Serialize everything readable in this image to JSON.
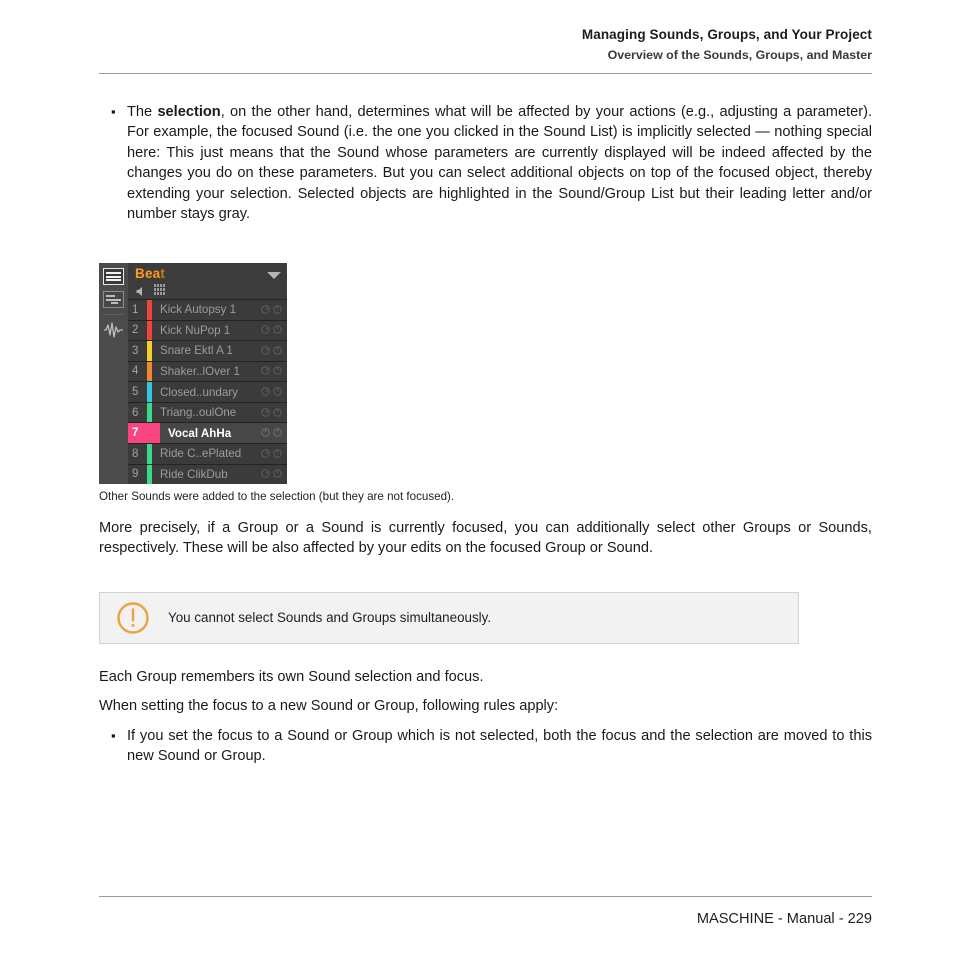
{
  "header": {
    "chapter": "Managing Sounds, Groups, and Your Project",
    "section": "Overview of the Sounds, Groups, and Master"
  },
  "content": {
    "bullet_1": {
      "marker": "▪",
      "text_before_bold": "The ",
      "bold": "selection",
      "text_after_bold": ", on the other hand, determines what will be affected by your actions (e.g., adjusting a parameter). For example, the focused Sound (i.e. the one you clicked in the Sound List) is implicitly selected — nothing special here: This just means that the Sound whose parameters are currently displayed will be indeed affected by the changes you do on these parameters. But you can select additional objects on top of the focused object, thereby extending your selection. Selected objects are highlighted in the Sound/Group List but their leading letter and/or number stays gray."
    },
    "caption": "Other Sounds were added to the selection (but they are not focused).",
    "para_1": "More precisely, if a Group or a Sound is currently focused, you can additionally select other Groups or Sounds, respectively. These will be also affected by your edits on the focused Group or Sound.",
    "note": {
      "icon": "exclamation-circle-icon",
      "text": "You cannot select Sounds and Groups simultaneously.",
      "accent_color": "#eba33f"
    },
    "para_2": "Each Group remembers its own Sound selection and focus.",
    "para_3": "When setting the focus to a new Sound or Group, following rules apply:",
    "bullet_2": {
      "marker": "▪",
      "text": "If you set the focus to a Sound or Group which is not selected, both the focus and the selection are moved to this new Sound or Group."
    }
  },
  "screenshot": {
    "sidebar": {
      "items": [
        {
          "name": "browser-list-icon",
          "active": true
        },
        {
          "name": "mixer-icon",
          "active": false
        },
        {
          "name": "waveform-icon",
          "active": false
        }
      ]
    },
    "group_header": {
      "name_bright": "Bea",
      "name_dim": "t",
      "name_color": "#ff9b1c",
      "speaker_icon": "speaker-icon",
      "grid_icon": "pad-grid-icon",
      "caret_icon": "chevron-down-icon"
    },
    "sound_rows": [
      {
        "number": "1",
        "name": "Kick Autopsy 1",
        "color": "#f04438",
        "state": "selected"
      },
      {
        "number": "2",
        "name": "Kick NuPop 1",
        "color": "#f04438",
        "state": "selected"
      },
      {
        "number": "3",
        "name": "Snare Ektl A 1",
        "color": "#f2d024",
        "state": "selected"
      },
      {
        "number": "4",
        "name": "Shaker..lOver 1",
        "color": "#f08a2a",
        "state": "selected"
      },
      {
        "number": "5",
        "name": "Closed..undary",
        "color": "#34c3e0",
        "state": "selected"
      },
      {
        "number": "6",
        "name": "Triang..oulOne",
        "color": "#3ad98a",
        "state": "selected"
      },
      {
        "number": "7",
        "name": "Vocal AhHa",
        "color": "#f9447f",
        "state": "focused"
      },
      {
        "number": "8",
        "name": "Ride C..ePlated",
        "color": "#3ad98a",
        "state": "selected"
      },
      {
        "number": "9",
        "name": "Ride ClikDub",
        "color": "#3ad98a",
        "state": "selected"
      }
    ]
  },
  "footer": {
    "text": "MASCHINE - Manual - 229"
  }
}
